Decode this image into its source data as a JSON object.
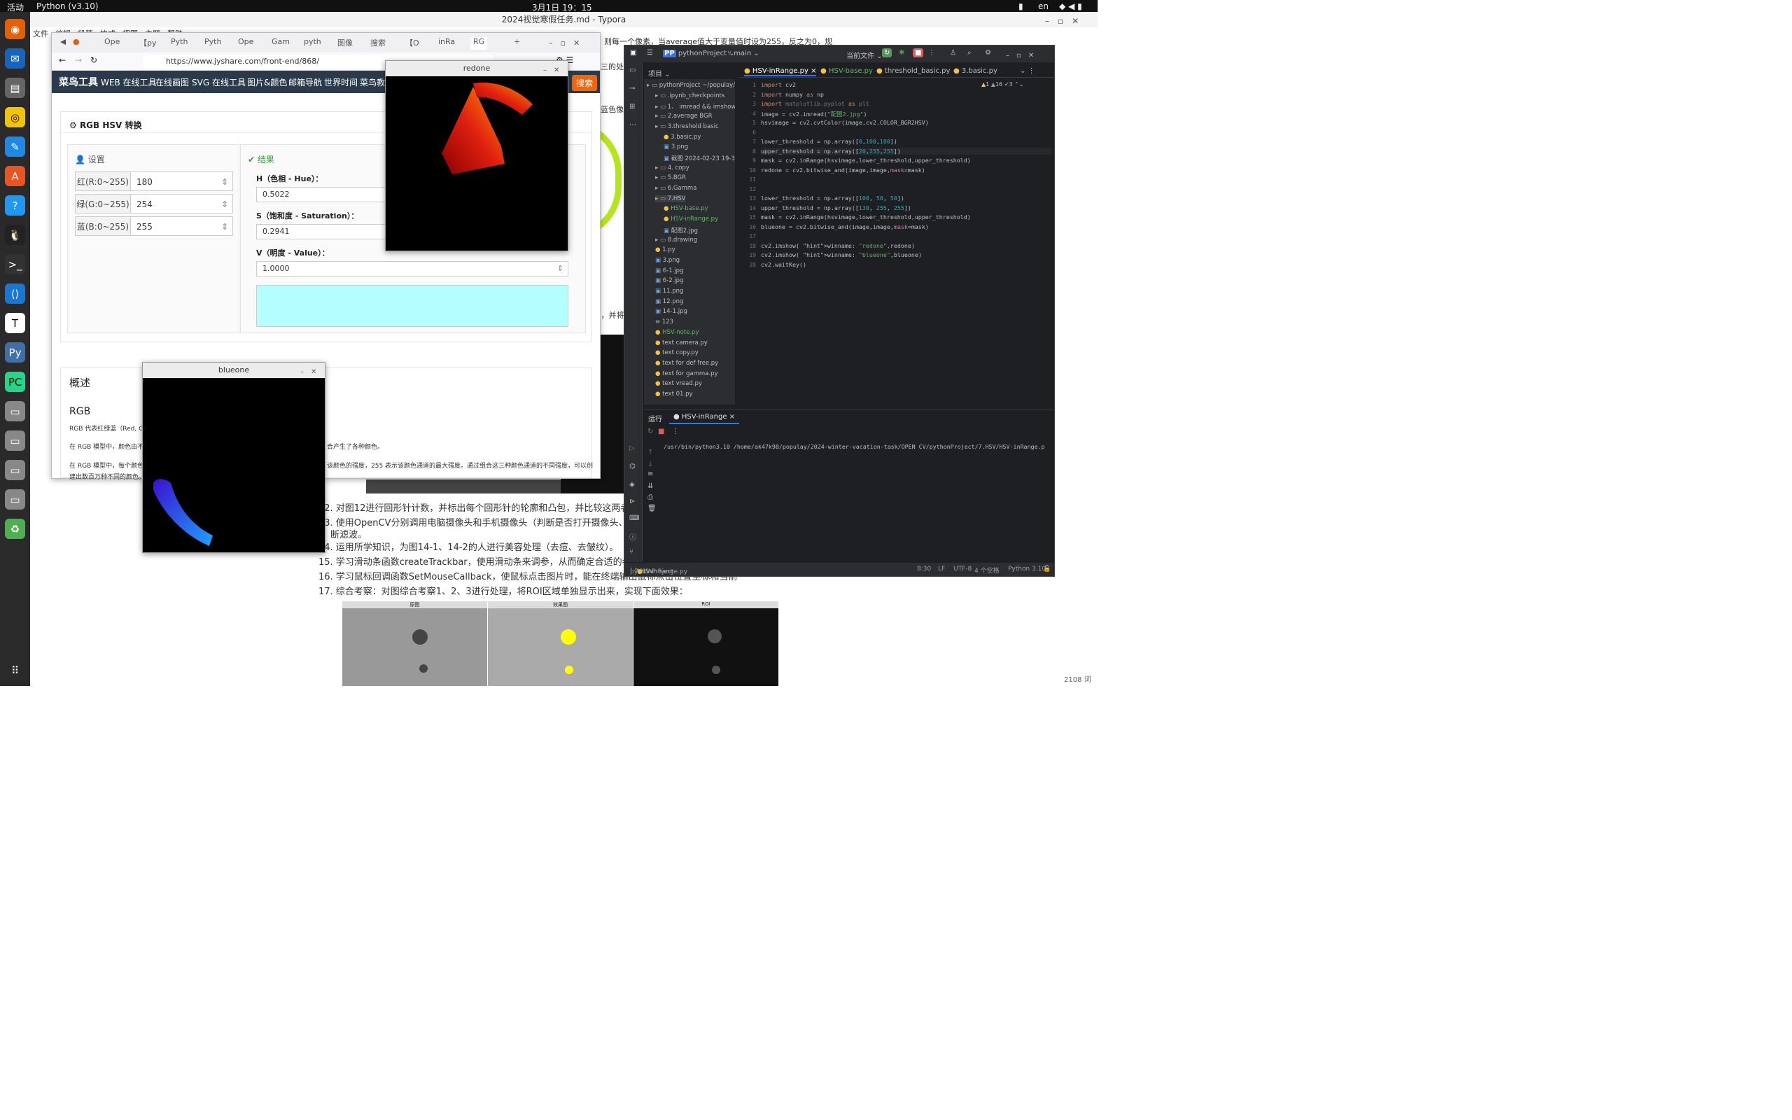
{
  "topbar": {
    "activities": "活动",
    "app": "Python (v3.10)",
    "clock": "3月1日 19：15",
    "lang": "en"
  },
  "typora": {
    "window_title": "2024视觉寒假任务.md - Typora",
    "menu": [
      "文件",
      "编辑",
      "段落",
      "格式",
      "视图",
      "主题",
      "帮助"
    ],
    "lines": [
      "12. 对图12进行回形针计数，并标出每个回形针的轮廓和凸包，并比较这两者有什么不同，思考凸包可",
      "13. 使用OpenCV分别调用电脑摄像头和手机摄像头（判断是否打开摄像头、判断是否成功读取图像）",
      "断滤波。",
      "14. 运用所学知识，为图14-1、14-2的人进行美容处理（去痘、去皱纹）。",
      "15. 学习滑动条函数createTrackbar，使用滑动条来调参，从而确定合适的参数（可以以调节二值化参",
      "16. 学习鼠标回调函数SetMouseCallback，使鼠标点击图片时，能在终端输出鼠标点击位置坐标和当前",
      "17. 综合考察：对图综合考察1、2、3进行处理，将ROI区域单独显示出来，实现下面效果："
    ],
    "side_fragments": {
      "top": "则每一个像素，当average值大于变量值时设为255，反之为0，规",
      "right1": "三的处理",
      "right2": "蓝色像素",
      "right3": "），并将"
    },
    "result_windows": [
      "原图",
      "效果图",
      "ROI"
    ],
    "word_count": "2108 词"
  },
  "firefox": {
    "tabs": [
      "Ope",
      "【py",
      "Pyth",
      "Pyth",
      "Ope",
      "Gam",
      "pyth",
      "图像",
      "搜索",
      "【O",
      "inRa",
      "RG"
    ],
    "url": "https://www.jyshare.com/front-end/868/",
    "nav": {
      "logo": "菜鸟工具",
      "items": [
        "WEB 在线工具",
        "在线画图",
        "SVG 在线工具",
        "图片&颜色",
        "邮箱导航",
        "世界时间",
        "菜鸟教程"
      ],
      "search": "搜索"
    },
    "tool_title": "RGB HSV 转换",
    "settings_label": "设置",
    "result_label": "结果",
    "inputs": [
      {
        "label": "红(R:0~255)",
        "value": "180"
      },
      {
        "label": "绿(G:0~255)",
        "value": "254"
      },
      {
        "label": "蓝(B:0~255)",
        "value": "255"
      }
    ],
    "outputs": [
      {
        "label": "H（色相 - Hue）：",
        "value": "0.5022"
      },
      {
        "label": "S（饱和度 - Saturation）：",
        "value": "0.2941"
      },
      {
        "label": "V（明度 - Value）：",
        "value": "1.0000"
      }
    ],
    "swatch_color": "#b4feff",
    "overview": "概述",
    "rgb_heading": "RGB",
    "para1": "RGB 代表红绿蓝（Red, Gre",
    "para2": "在 RGB 模型中，颜色由不同",
    "para2b": "合产生了各种颜色。",
    "para3": "在 RGB 模型中，每个颜色通",
    "para3b": "该颜色的强度，255 表示该颜色通道的最大强度。通过组合这三种颜色通道的不同强度，可以创",
    "para3c": "建出数百万种不同的颜色。"
  },
  "redone": {
    "title": "redone"
  },
  "blueone": {
    "title": "blueone"
  },
  "pycharm": {
    "project": "pythonProject",
    "branch": "main",
    "run_config": "当前文件",
    "project_label": "项目",
    "tabs": [
      "HSV-inRange.py",
      "HSV-base.py",
      "threshold_basic.py",
      "3.basic.py"
    ],
    "inspections": {
      "warn": "1",
      "weak": "16",
      "ok": "3"
    },
    "tree": [
      {
        "name": "pythonProject",
        "hint": "~/populay/20",
        "d": 0,
        "t": "dir"
      },
      {
        "name": ".ipynb_checkpoints",
        "d": 1,
        "t": "dir"
      },
      {
        "name": "1、 imread && imshow",
        "d": 1,
        "t": "dir"
      },
      {
        "name": "2.average BGR",
        "d": 1,
        "t": "dir"
      },
      {
        "name": "3.threshold basic",
        "d": 1,
        "t": "dir"
      },
      {
        "name": "3.basic.py",
        "d": 2,
        "t": "py"
      },
      {
        "name": "3.png",
        "d": 2,
        "t": "img"
      },
      {
        "name": "截图 2024-02-23 19-3",
        "d": 2,
        "t": "img"
      },
      {
        "name": "4. copy",
        "d": 1,
        "t": "dir"
      },
      {
        "name": "5.BGR",
        "d": 1,
        "t": "dir"
      },
      {
        "name": "6.Gamma",
        "d": 1,
        "t": "dir"
      },
      {
        "name": "7.HSV",
        "d": 1,
        "t": "dir"
      },
      {
        "name": "HSV-base.py",
        "d": 2,
        "t": "py"
      },
      {
        "name": "HSV-inRange.py",
        "d": 2,
        "t": "py"
      },
      {
        "name": "配图2.jpg",
        "d": 2,
        "t": "img"
      },
      {
        "name": "8.drawing",
        "d": 1,
        "t": "dir"
      },
      {
        "name": "1.py",
        "d": 1,
        "t": "py"
      },
      {
        "name": "3.png",
        "d": 1,
        "t": "img"
      },
      {
        "name": "6-1.jpg",
        "d": 1,
        "t": "img"
      },
      {
        "name": "6-2.jpg",
        "d": 1,
        "t": "img"
      },
      {
        "name": "11.png",
        "d": 1,
        "t": "img"
      },
      {
        "name": "12.png",
        "d": 1,
        "t": "img"
      },
      {
        "name": "14-1.jpg",
        "d": 1,
        "t": "img"
      },
      {
        "name": "123",
        "d": 1,
        "t": "txt"
      },
      {
        "name": "HSV-note.py",
        "d": 1,
        "t": "py"
      },
      {
        "name": "text camera.py",
        "d": 1,
        "t": "py"
      },
      {
        "name": "text copy.py",
        "d": 1,
        "t": "py"
      },
      {
        "name": "text for def free.py",
        "d": 1,
        "t": "py"
      },
      {
        "name": "text for gamma.py",
        "d": 1,
        "t": "py"
      },
      {
        "name": "text vread.py",
        "d": 1,
        "t": "py"
      },
      {
        "name": "text 01.py",
        "d": 1,
        "t": "py"
      }
    ],
    "code": [
      "import cv2",
      "import numpy as np",
      "import matplotlib.pyplot as plt",
      "image = cv2.imread(\"配图2.jpg\")",
      "hsvimage = cv2.cvtColor(image,cv2.COLOR_BGR2HSV)",
      "",
      "lower_threshold = np.array([0,100,100])",
      "upper_threshold = np.array([20,255,255])",
      "mask = cv2.inRange(hsvimage,lower_threshold,upper_threshold)",
      "redone = cv2.bitwise_and(image,image,mask=mask)",
      "",
      "",
      "lower_threshold = np.array([100, 50, 50])",
      "upper_threshold = np.array([130, 255, 255])",
      "mask = cv2.inRange(hsvimage,lower_threshold,upper_threshold)",
      "blueone = cv2.bitwise_and(image,image,mask=mask)",
      "",
      "cv2.imshow( winname: \"redone\",redone)",
      "cv2.imshow( winname: \"blueone\",blueone)",
      "cv2.waitKey()"
    ],
    "run_label": "运行",
    "run_tab": "HSV-inRange",
    "run_cmd": "/usr/bin/python3.10 /home/ak47k98/populay/2024-winter-vacation-task/OPEN CV/pythonProject/7.HSV/HSV-inRange.p",
    "status": {
      "crumbs": [
        "pythonProject",
        "7.HSV",
        "HSV-inRange.py"
      ],
      "pos": "8:30",
      "lf": "LF",
      "enc": "UTF-8",
      "indent": "4 个空格",
      "interp": "Python 3.10"
    }
  }
}
